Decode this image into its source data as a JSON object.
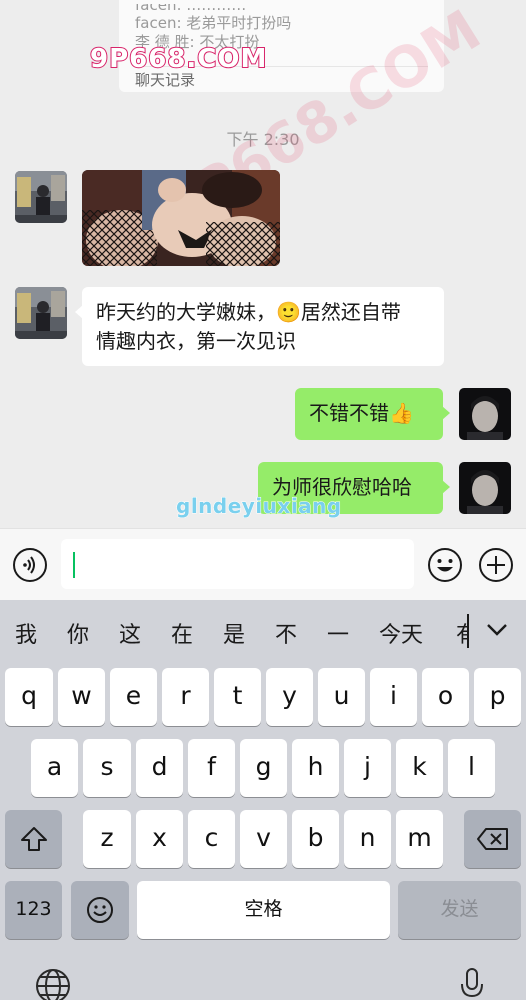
{
  "chat": {
    "quote": {
      "line_cut": "facen: …………",
      "line1": "facen: 老弟平时打扮吗",
      "line2": "李 德 胜: 不太打扮",
      "footer": "聊天记录"
    },
    "watermark_top": "9P668.COM",
    "watermark_diagonal": "9P668.COM",
    "timestamp": "下午 2:30",
    "messages": [
      {
        "side": "left",
        "type": "image"
      },
      {
        "side": "left",
        "type": "text",
        "line1": "昨天约的大学嫩妹，",
        "emoji": "🙂",
        "line1b": "居然还自带",
        "line2": "情趣内衣，第一次见识"
      },
      {
        "side": "right",
        "type": "text",
        "text": "不错不错",
        "emoji": "👍"
      },
      {
        "side": "right",
        "type": "text",
        "text": "为师很欣慰哈哈"
      }
    ],
    "watermark_text": "glndeyiuxiang"
  },
  "input_bar": {
    "voice_icon": "voice-icon",
    "emoji_icon": "smile-icon",
    "plus_icon": "plus-icon",
    "value": ""
  },
  "keyboard": {
    "candidates": [
      "我",
      "你",
      "这",
      "在",
      "是",
      "不",
      "一",
      "今天",
      "有"
    ],
    "row1": [
      "q",
      "w",
      "e",
      "r",
      "t",
      "y",
      "u",
      "i",
      "o",
      "p"
    ],
    "row2": [
      "a",
      "s",
      "d",
      "f",
      "g",
      "h",
      "j",
      "k",
      "l"
    ],
    "row3": [
      "z",
      "x",
      "c",
      "v",
      "b",
      "n",
      "m"
    ],
    "numbers_label": "123",
    "space_label": "空格",
    "send_label": "发送"
  },
  "colors": {
    "chat_bg": "#ededed",
    "sent_bubble": "#95ec69",
    "received_bubble": "#ffffff",
    "caret": "#07c160",
    "keyboard_bg": "#d1d3d9"
  }
}
